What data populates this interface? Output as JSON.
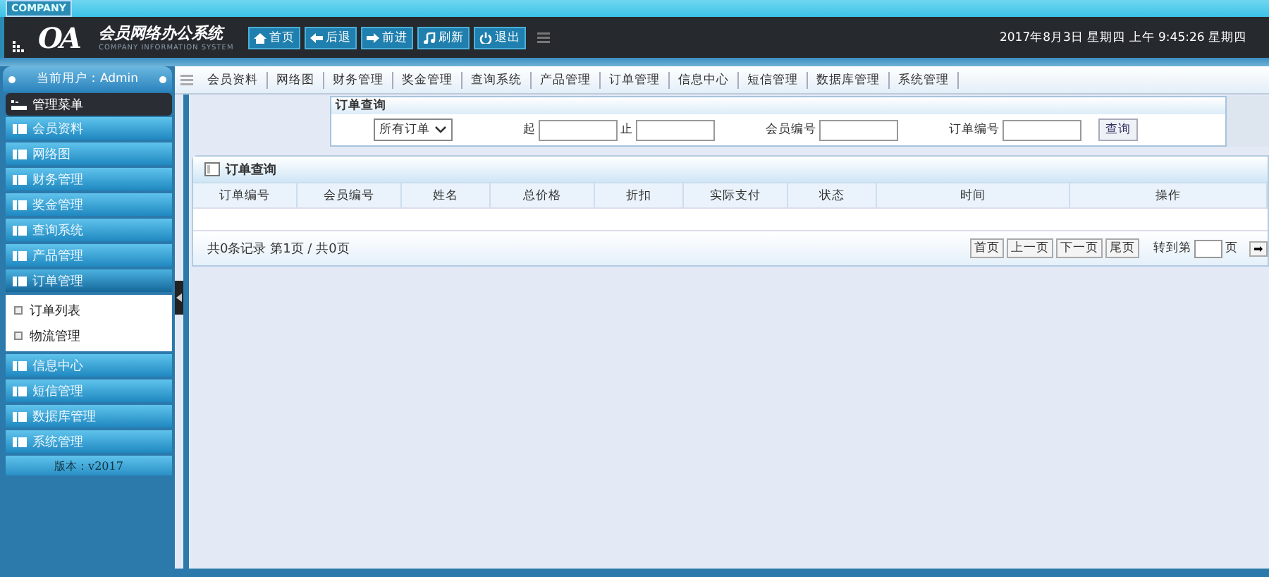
{
  "header": {
    "company_label": "COMPANY",
    "logo": "OA",
    "title": "会员网络办公系统",
    "subtitle": "COMPANY INFORMATION SYSTEM",
    "buttons": [
      {
        "label": "首页",
        "kind": "home"
      },
      {
        "label": "后退",
        "kind": "back"
      },
      {
        "label": "前进",
        "kind": "forward"
      },
      {
        "label": "刷新",
        "kind": "refresh"
      },
      {
        "label": "退出",
        "kind": "power"
      }
    ],
    "datetime": "2017年8月3日 星期四 上午 9:45:26 星期四"
  },
  "current_user": "当前用户：Admin",
  "nav_links": [
    "会员资料",
    "网络图",
    "财务管理",
    "奖金管理",
    "查询系统",
    "产品管理",
    "订单管理",
    "信息中心",
    "短信管理",
    "数据库管理",
    "系统管理"
  ],
  "sidebar": {
    "title": "管理菜单",
    "items": [
      {
        "label": "会员资料",
        "expanded": false
      },
      {
        "label": "网络图",
        "expanded": false
      },
      {
        "label": "财务管理",
        "expanded": false
      },
      {
        "label": "奖金管理",
        "expanded": false
      },
      {
        "label": "查询系统",
        "expanded": false
      },
      {
        "label": "产品管理",
        "expanded": false
      },
      {
        "label": "订单管理",
        "expanded": true,
        "children": [
          {
            "label": "订单列表"
          },
          {
            "label": "物流管理"
          }
        ]
      },
      {
        "label": "信息中心",
        "expanded": false
      },
      {
        "label": "短信管理",
        "expanded": false
      },
      {
        "label": "数据库管理",
        "expanded": false
      },
      {
        "label": "系统管理",
        "expanded": false
      }
    ],
    "version": "版本：v2017"
  },
  "query": {
    "title": "订单查询",
    "select_value": "所有订单",
    "from_label": "起",
    "to_label": "止",
    "member_label": "会员编号",
    "order_label": "订单编号",
    "button": "查询"
  },
  "table": {
    "title": "订单查询",
    "columns": [
      "订单编号",
      "会员编号",
      "姓名",
      "总价格",
      "折扣",
      "实际支付",
      "状态",
      "时间",
      "操作"
    ],
    "summary": "共0条记录  第1页 / 共0页",
    "pager": [
      "首页",
      "上一页",
      "下一页",
      "尾页"
    ],
    "goto_label": "转到第",
    "page_label": "页",
    "go_button": "➡"
  }
}
